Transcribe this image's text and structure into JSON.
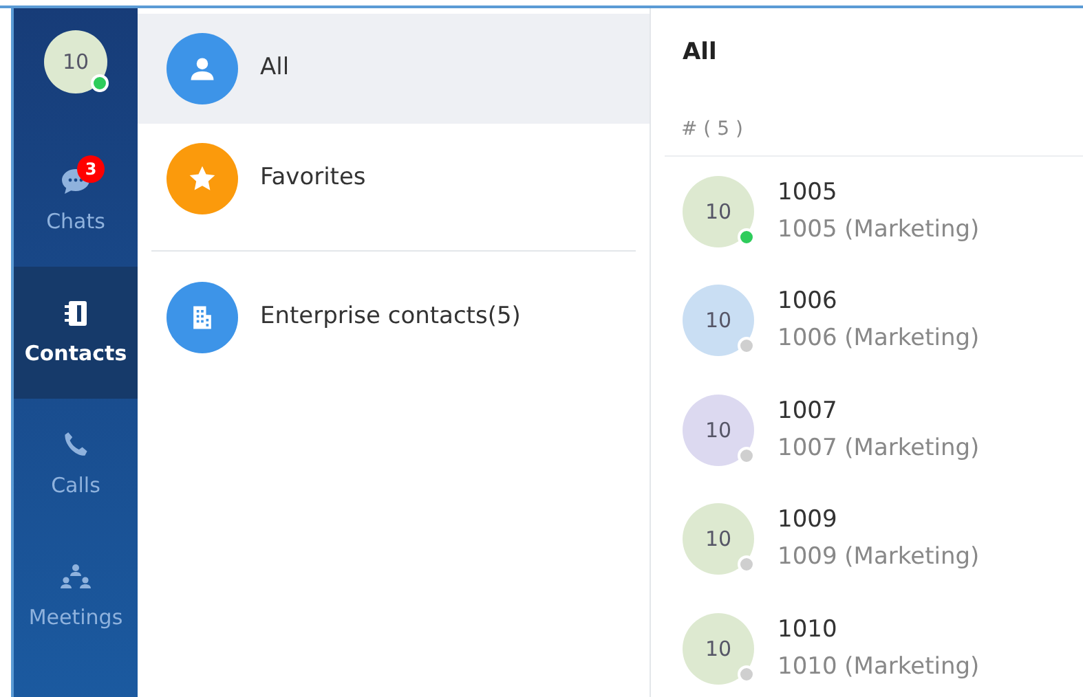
{
  "user": {
    "avatar_text": "10",
    "online": true
  },
  "nav": [
    {
      "kind": "chat",
      "label": "Chats",
      "selected": false,
      "badge": "3"
    },
    {
      "kind": "contacts",
      "label": "Contacts",
      "selected": true
    },
    {
      "kind": "calls",
      "label": "Calls",
      "selected": false
    },
    {
      "kind": "meetings",
      "label": "Meetings",
      "selected": false
    }
  ],
  "groups": [
    {
      "kind": "person",
      "label": "All",
      "selected": true,
      "color": "#3d94e8"
    },
    {
      "kind": "star",
      "label": "Favorites",
      "selected": false,
      "color": "#fb9a0c"
    },
    {
      "kind": "divider"
    },
    {
      "kind": "building",
      "label": "Enterprise contacts(5)",
      "selected": false,
      "color": "#3d94e8"
    }
  ],
  "list": {
    "title": "All",
    "section": "# ( 5 )",
    "contacts": [
      {
        "avatar_text": "10",
        "color": "#dde9d0",
        "name": "1005",
        "detail": "1005 (Marketing)",
        "online": true
      },
      {
        "avatar_text": "10",
        "color": "#c9def3",
        "name": "1006",
        "detail": "1006 (Marketing)",
        "online": false
      },
      {
        "avatar_text": "10",
        "color": "#dcd9f0",
        "name": "1007",
        "detail": "1007 (Marketing)",
        "online": false
      },
      {
        "avatar_text": "10",
        "color": "#dde9d0",
        "name": "1009",
        "detail": "1009 (Marketing)",
        "online": false
      },
      {
        "avatar_text": "10",
        "color": "#dde9d0",
        "name": "1010",
        "detail": "1010 (Marketing)",
        "online": false
      }
    ]
  }
}
